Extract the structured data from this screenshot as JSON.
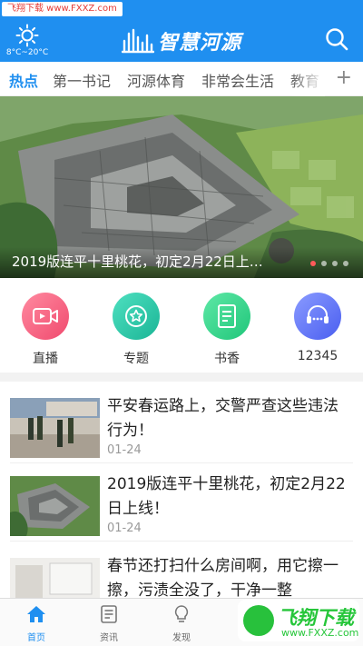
{
  "watermark": {
    "top": "飞翔下载 www.FXXZ.com",
    "bottom_big": "飞翔下载",
    "bottom_small": "www.FXXZ.com"
  },
  "header": {
    "weather_temp": "8°C~20°C",
    "title": "智慧河源",
    "colors": {
      "bar": "#1f8ff0",
      "text": "#ffffff"
    }
  },
  "tabs": [
    "热点",
    "第一书记",
    "河源体育",
    "非常会生活",
    "教育"
  ],
  "tabs_more": "+",
  "banner": {
    "title": "2019版连平十里桃花，初定2月22日上…",
    "dots": 4,
    "active_dot": 0
  },
  "quick": [
    {
      "label": "直播",
      "icon": "video-camera-icon",
      "color": "#f25a7a"
    },
    {
      "label": "专题",
      "icon": "star-badge-icon",
      "color": "#25c3a6"
    },
    {
      "label": "书香",
      "icon": "book-icon",
      "color": "#2fd28a"
    },
    {
      "label": "12345",
      "icon": "service-chat-icon",
      "color": "#5a6cf0"
    }
  ],
  "news": [
    {
      "title": "平安春运路上，交警严查这些违法行为！",
      "date": "01-24"
    },
    {
      "title": "2019版连平十里桃花，初定2月22日上线！",
      "date": "01-24"
    },
    {
      "title": "春节还打扫什么房间啊，用它擦一擦，污渍全没了，干净一整",
      "date": ""
    }
  ],
  "bottom_nav": [
    {
      "label": "首页",
      "icon": "home-icon",
      "active": true
    },
    {
      "label": "资讯",
      "icon": "news-icon",
      "active": false
    },
    {
      "label": "发现",
      "icon": "lightbulb-icon",
      "active": false
    }
  ]
}
